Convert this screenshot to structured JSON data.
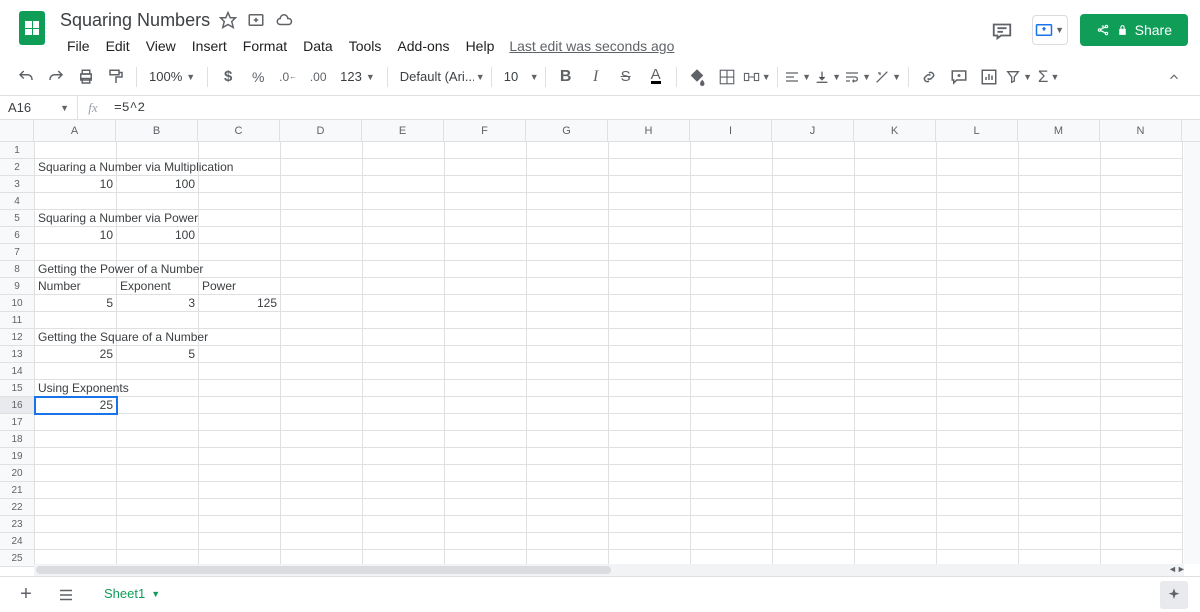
{
  "doc": {
    "title": "Squaring Numbers",
    "last_edit": "Last edit was seconds ago"
  },
  "menus": [
    "File",
    "Edit",
    "View",
    "Insert",
    "Format",
    "Data",
    "Tools",
    "Add-ons",
    "Help"
  ],
  "toolbar": {
    "zoom": "100%",
    "number_format": "123",
    "font": "Default (Ari...",
    "size": "10"
  },
  "name_box": "A16",
  "formula": "=5^2",
  "columns": [
    "A",
    "B",
    "C",
    "D",
    "E",
    "F",
    "G",
    "H",
    "I",
    "J",
    "K",
    "L",
    "M",
    "N"
  ],
  "rows": 25,
  "selected_cell": {
    "row": 16,
    "col": 0
  },
  "sheet_tab": "Sheet1",
  "share_label": "Share",
  "cells": {
    "r2c0": {
      "v": "Squaring a Number via Multiplication",
      "t": "text",
      "overflow": true
    },
    "r3c0": {
      "v": "10",
      "t": "num"
    },
    "r3c1": {
      "v": "100",
      "t": "num"
    },
    "r5c0": {
      "v": "Squaring a Number via Power",
      "t": "text",
      "overflow": true
    },
    "r6c0": {
      "v": "10",
      "t": "num"
    },
    "r6c1": {
      "v": "100",
      "t": "num"
    },
    "r8c0": {
      "v": "Getting the Power of a Number",
      "t": "text",
      "overflow": true
    },
    "r9c0": {
      "v": "Number",
      "t": "text"
    },
    "r9c1": {
      "v": "Exponent",
      "t": "text"
    },
    "r9c2": {
      "v": "Power",
      "t": "text"
    },
    "r10c0": {
      "v": "5",
      "t": "num"
    },
    "r10c1": {
      "v": "3",
      "t": "num"
    },
    "r10c2": {
      "v": "125",
      "t": "num"
    },
    "r12c0": {
      "v": "Getting the Square of a Number",
      "t": "text",
      "overflow": true
    },
    "r13c0": {
      "v": "25",
      "t": "num"
    },
    "r13c1": {
      "v": "5",
      "t": "num"
    },
    "r15c0": {
      "v": "Using Exponents",
      "t": "text",
      "overflow": true
    },
    "r16c0": {
      "v": "25",
      "t": "num"
    }
  }
}
